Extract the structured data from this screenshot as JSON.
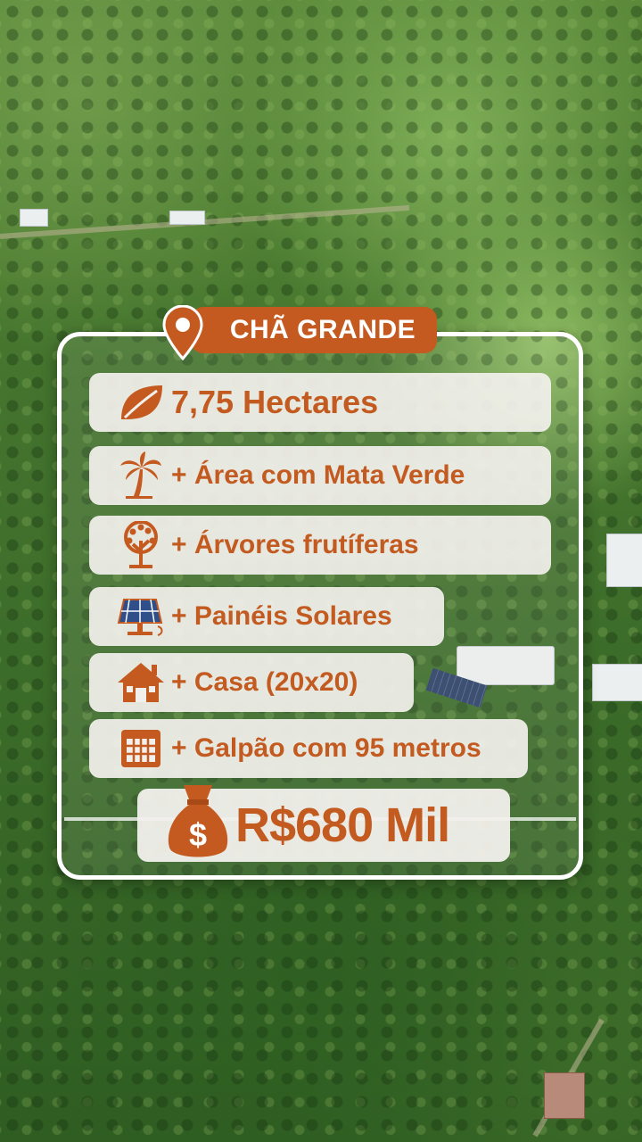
{
  "location": {
    "name": "CHÃ GRANDE"
  },
  "features": [
    {
      "icon": "leaf-icon",
      "label": "7,75 Hectares"
    },
    {
      "icon": "palm-tree-icon",
      "label": "+ Área com Mata Verde"
    },
    {
      "icon": "fruit-tree-icon",
      "label": "+ Árvores frutíferas"
    },
    {
      "icon": "solar-panel-icon",
      "label": "+ Painéis Solares"
    },
    {
      "icon": "house-icon",
      "label": "+ Casa (20x20)"
    },
    {
      "icon": "warehouse-icon",
      "label": "+ Galpão com 95 metros"
    }
  ],
  "price": {
    "icon": "money-bag-icon",
    "label": "R$680 Mil"
  },
  "colors": {
    "accent": "#c45a1f",
    "card_border": "#ffffff",
    "row_bg": "#f2f0ec"
  }
}
